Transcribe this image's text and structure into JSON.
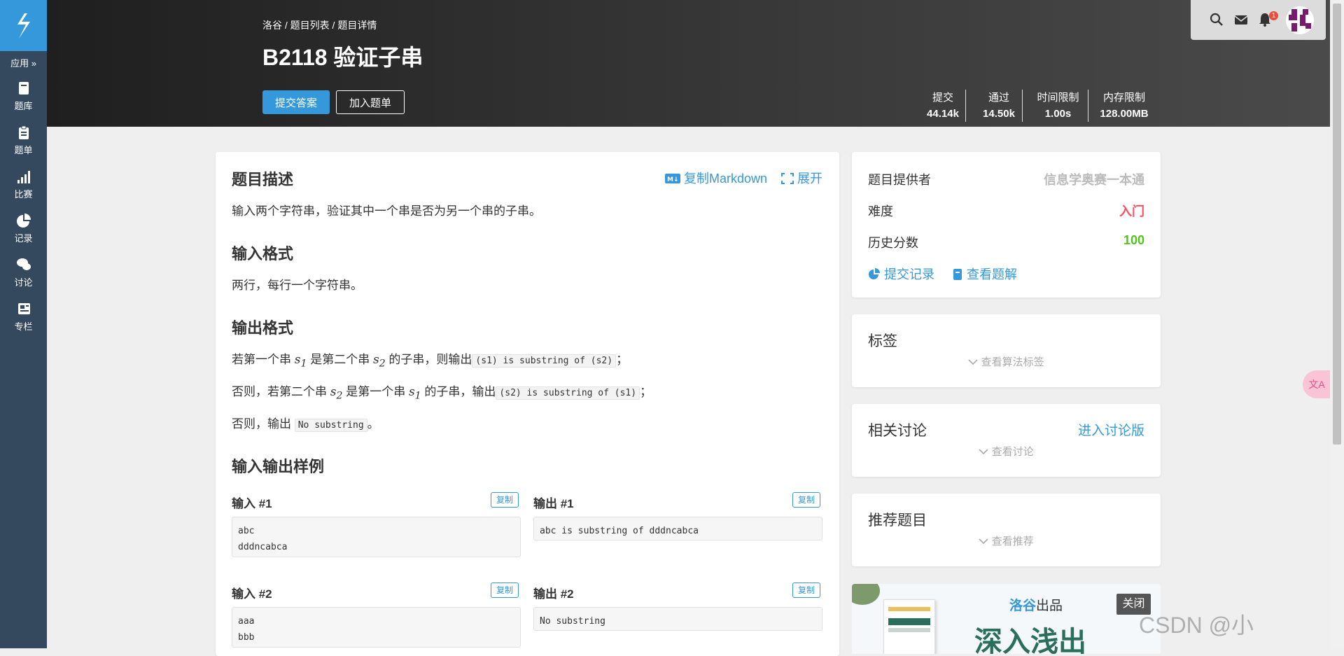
{
  "sidebar": {
    "logo_icon": "luogu-logo-icon",
    "apps_label": "应用 »",
    "items": [
      {
        "label": "题库",
        "icon": "book-icon"
      },
      {
        "label": "题单",
        "icon": "clipboard-icon"
      },
      {
        "label": "比赛",
        "icon": "signal-bars-icon"
      },
      {
        "label": "记录",
        "icon": "pie-chart-icon"
      },
      {
        "label": "讨论",
        "icon": "comments-icon"
      },
      {
        "label": "专栏",
        "icon": "newspaper-icon"
      }
    ]
  },
  "header": {
    "breadcrumb": "洛谷 / 题目列表 / 题目详情",
    "title": "B2118 验证子串",
    "submit_label": "提交答案",
    "add_label": "加入题单",
    "stats": [
      {
        "key": "提交",
        "value": "44.14k"
      },
      {
        "key": "通过",
        "value": "14.50k"
      },
      {
        "key": "时间限制",
        "value": "1.00s"
      },
      {
        "key": "内存限制",
        "value": "128.00MB"
      }
    ],
    "notification_count": "1"
  },
  "problem": {
    "copy_markdown": "复制Markdown",
    "expand": "展开",
    "desc_title": "题目描述",
    "desc_text": "输入两个字符串，验证其中一个串是否为另一个串的子串。",
    "input_title": "输入格式",
    "input_text": "两行，每行一个字符串。",
    "output_title": "输出格式",
    "out1_a": "若第一个串 ",
    "out1_s1": "s",
    "out1_s1_sub": "1",
    "out1_b": " 是第二个串 ",
    "out1_s2": "s",
    "out1_s2_sub": "2",
    "out1_c": " 的子串，则输出",
    "out1_code": "(s1) is substring of (s2)",
    "out1_end": "；",
    "out2_a": "否则，若第二个串 ",
    "out2_s2": "s",
    "out2_s2_sub": "2",
    "out2_b": " 是第一个串 ",
    "out2_s1": "s",
    "out2_s1_sub": "1",
    "out2_c": " 的子串，输出",
    "out2_code": "(s2) is substring of (s1)",
    "out2_end": "；",
    "out3_a": "否则，输出 ",
    "out3_code": "No substring",
    "out3_end": "。",
    "samples_title": "输入输出样例",
    "copy_label": "复制",
    "samples": [
      {
        "in_label": "输入 #1",
        "in": "abc\ndddncabca",
        "out_label": "输出 #1",
        "out": "abc is substring of dddncabca"
      },
      {
        "in_label": "输入 #2",
        "in": "aaa\nbbb",
        "out_label": "输出 #2",
        "out": "No substring"
      }
    ]
  },
  "info": {
    "provider_label": "题目提供者",
    "provider_value": "信息学奥赛一本通",
    "difficulty_label": "难度",
    "difficulty_value": "入门",
    "score_label": "历史分数",
    "score_value": "100",
    "records_link": "提交记录",
    "solutions_link": "查看题解",
    "colors": {
      "difficulty": "#fe4c61",
      "score": "#52c41a",
      "provider": "#bbbbbb",
      "accent": "#3498db"
    }
  },
  "tags": {
    "title": "标签",
    "toggle": "查看算法标签"
  },
  "discussion": {
    "title": "相关讨论",
    "link": "进入讨论版",
    "toggle": "查看讨论"
  },
  "recommend": {
    "title": "推荐题目",
    "toggle": "查看推荐"
  },
  "ad": {
    "brand": "洛谷",
    "brand_suffix": "出品",
    "headline": "深入浅出",
    "close": "关闭"
  },
  "translate": {
    "label": "文A"
  },
  "watermark": "CSDN @小"
}
